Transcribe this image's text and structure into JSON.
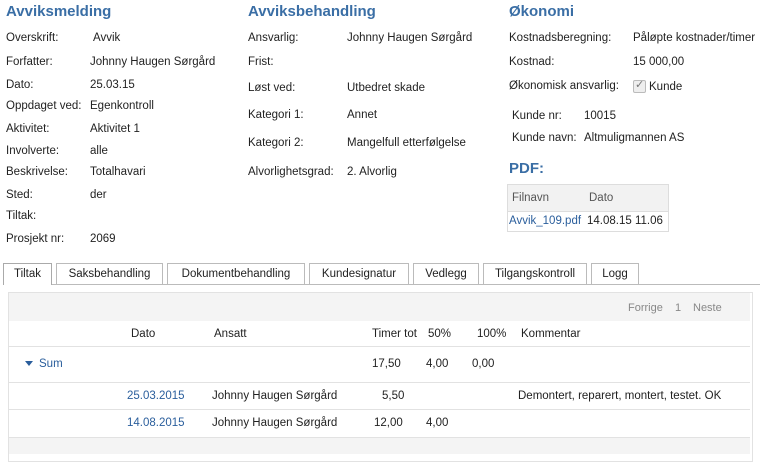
{
  "avviksmelding": {
    "title": "Avviksmelding",
    "rows": [
      {
        "label": "Overskrift:",
        "value": "Avvik"
      },
      {
        "label": "Forfatter:",
        "value": "Johnny Haugen Sørgård"
      },
      {
        "label": "Dato:",
        "value": "25.03.15"
      },
      {
        "label": "Oppdaget ved:",
        "value": "Egenkontroll"
      },
      {
        "label": "Aktivitet:",
        "value": "Aktivitet 1"
      },
      {
        "label": "Involverte:",
        "value": "alle"
      },
      {
        "label": "Beskrivelse:",
        "value": "Totalhavari"
      },
      {
        "label": "Sted:",
        "value": "der"
      },
      {
        "label": "Tiltak:",
        "value": ""
      },
      {
        "label": "Prosjekt nr:",
        "value": "2069"
      }
    ]
  },
  "avviksbehandling": {
    "title": "Avviksbehandling",
    "rows": [
      {
        "label": "Ansvarlig:",
        "value": "Johnny Haugen Sørgård"
      },
      {
        "label": "Frist:",
        "value": ""
      },
      {
        "label": "Løst ved:",
        "value": "Utbedret skade"
      },
      {
        "label": "Kategori 1:",
        "value": "Annet"
      },
      {
        "label": "Kategori 2:",
        "value": "Mangelfull etterfølgelse"
      },
      {
        "label": "Alvorlighetsgrad:",
        "value": "2. Alvorlig"
      }
    ]
  },
  "okonomi": {
    "title": "Økonomi",
    "kostnadsberegning_label": "Kostnadsberegning:",
    "kostnadsberegning_value": "Påløpte kostnader/timer",
    "kostnad_label": "Kostnad:",
    "kostnad_value": "15 000,00",
    "ansvarlig_label": "Økonomisk ansvarlig:",
    "ansvarlig_value": "Kunde",
    "ansvarlig_checked": true,
    "kunde_nr_label": "Kunde nr:",
    "kunde_nr_value": "10015",
    "kunde_navn_label": "Kunde navn:",
    "kunde_navn_value": "Altmuligmannen AS"
  },
  "pdf": {
    "title": "PDF:",
    "col_filnavn": "Filnavn",
    "col_dato": "Dato",
    "file_name": "Avvik_109.pdf",
    "file_date": "14.08.15 11.06"
  },
  "tabs": [
    "Tiltak",
    "Saksbehandling",
    "Dokumentbehandling",
    "Kundesignatur",
    "Vedlegg",
    "Tilgangskontroll",
    "Logg"
  ],
  "active_tab": "Tiltak",
  "pager": {
    "prev": "Forrige",
    "page": "1",
    "next": "Neste"
  },
  "grid": {
    "headers": {
      "dato": "Dato",
      "ansatt": "Ansatt",
      "timer_tot": "Timer tot",
      "p50": "50%",
      "p100": "100%",
      "kommentar": "Kommentar"
    },
    "sum": {
      "label": "Sum",
      "timer_tot": "17,50",
      "p50": "4,00",
      "p100": "0,00"
    },
    "rows": [
      {
        "dato": "25.03.2015",
        "ansatt": "Johnny Haugen Sørgård",
        "timer_tot": "5,50",
        "p50": "",
        "p100": "",
        "kommentar": "Demontert, reparert, montert, testet. OK"
      },
      {
        "dato": "14.08.2015",
        "ansatt": "Johnny Haugen Sørgård",
        "timer_tot": "12,00",
        "p50": "4,00",
        "p100": "",
        "kommentar": ""
      }
    ]
  },
  "colors": {
    "accent": "#3a6ea5",
    "link": "#2a5e9c"
  }
}
